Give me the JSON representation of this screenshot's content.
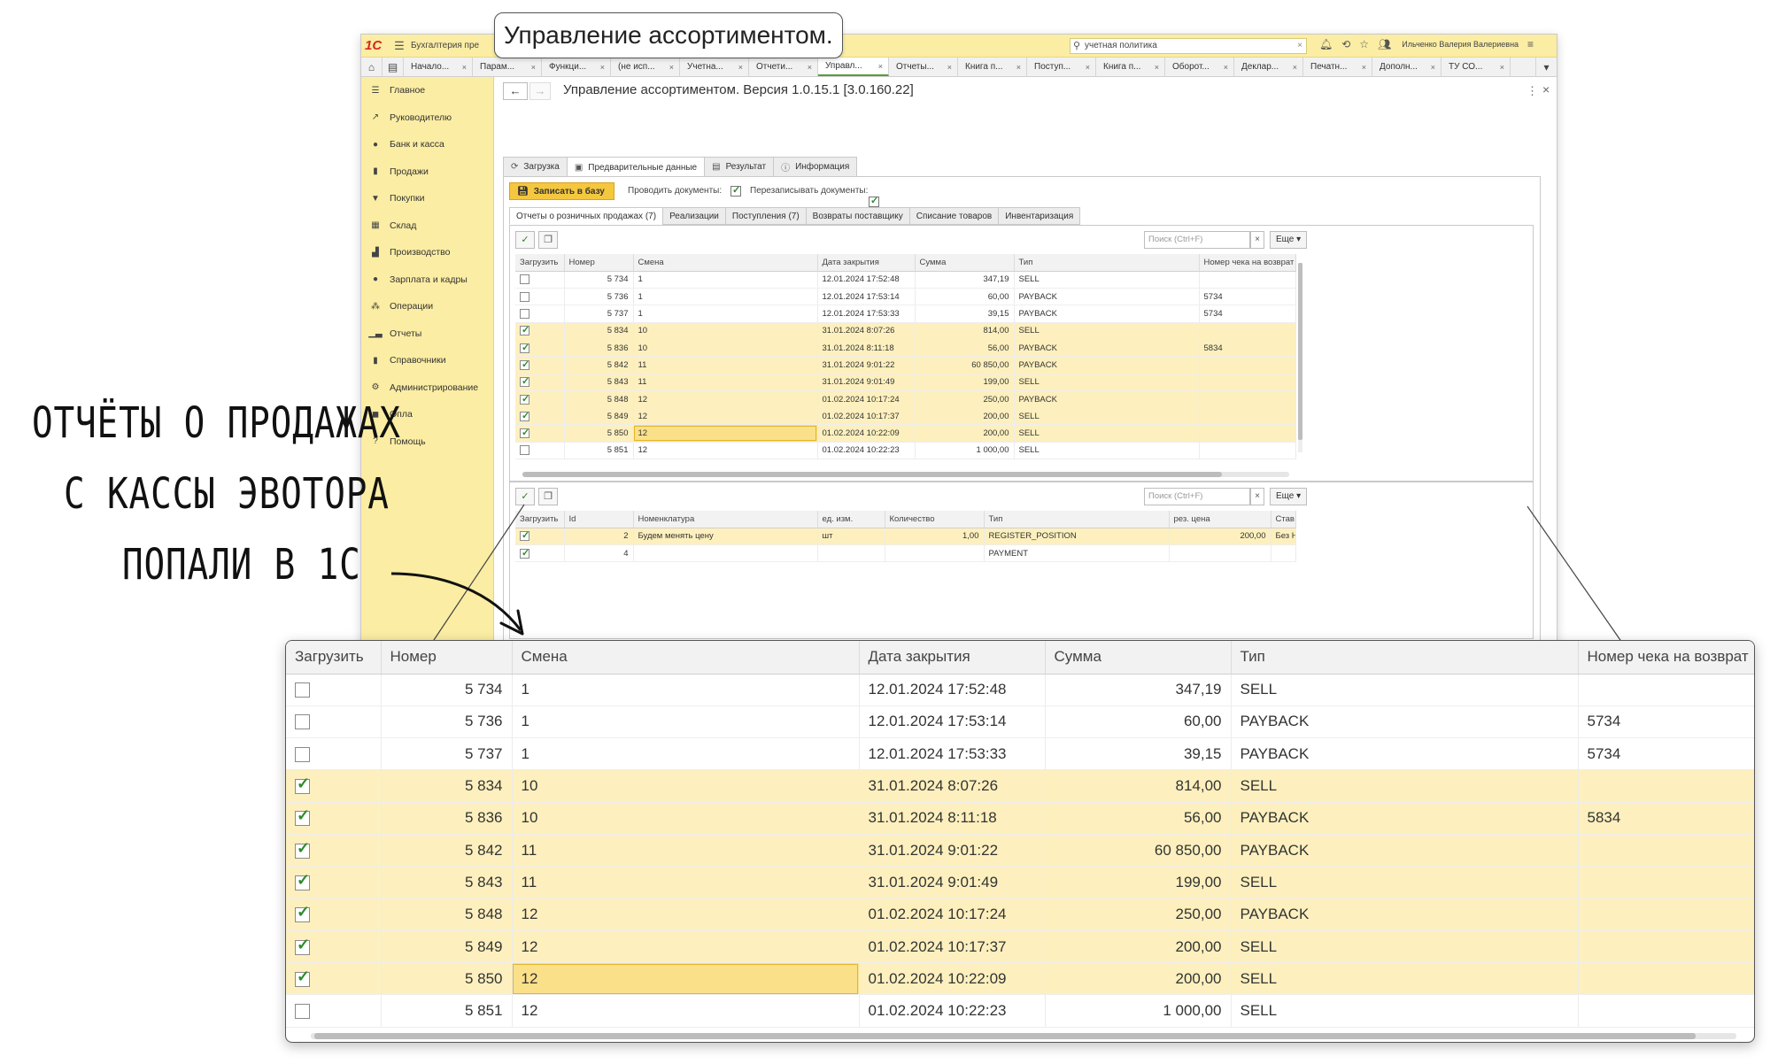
{
  "annotation": {
    "lines": [
      "ОТЧЁТЫ О ПРОДАЖАХ",
      "С КАССЫ ЭВОТОРА",
      "ПОПАЛИ В 1С"
    ]
  },
  "callout": {
    "text": "Управление ассортиментом."
  },
  "titlebar": {
    "logo": "1С",
    "app_name": "Бухгалтерия пре",
    "search_value": "учетная политика",
    "user": "Ильченко Валерия Валериевна"
  },
  "tabs": [
    {
      "label": "Начало..."
    },
    {
      "label": "Парам..."
    },
    {
      "label": "Функци..."
    },
    {
      "label": "(не исп..."
    },
    {
      "label": "Учетна..."
    },
    {
      "label": "Отчети..."
    },
    {
      "label": "Управл..."
    },
    {
      "label": "Отчеты..."
    },
    {
      "label": "Книга п..."
    },
    {
      "label": "Поступ..."
    },
    {
      "label": "Книга п..."
    },
    {
      "label": "Оборот..."
    },
    {
      "label": "Деклар..."
    },
    {
      "label": "Печатн..."
    },
    {
      "label": "Дополн..."
    },
    {
      "label": "ТУ СО..."
    }
  ],
  "active_tab_index": 6,
  "sidebar": {
    "items": [
      {
        "label": "Главное",
        "icon": "menu-icon"
      },
      {
        "label": "Руководителю",
        "icon": "trend-icon"
      },
      {
        "label": "Банк и касса",
        "icon": "coin-icon"
      },
      {
        "label": "Продажи",
        "icon": "bag-icon"
      },
      {
        "label": "Покупки",
        "icon": "cart-icon"
      },
      {
        "label": "Склад",
        "icon": "warehouse-icon"
      },
      {
        "label": "Производство",
        "icon": "factory-icon"
      },
      {
        "label": "Зарплата и кадры",
        "icon": "person-icon"
      },
      {
        "label": "Операции",
        "icon": "operations-icon"
      },
      {
        "label": "Отчеты",
        "icon": "bar-chart-icon"
      },
      {
        "label": "Справочники",
        "icon": "book-icon"
      },
      {
        "label": "Администрирование",
        "icon": "gear-icon"
      },
      {
        "label": "Опла",
        "icon": "payment-icon"
      },
      {
        "label": "Помощь",
        "icon": "help-icon"
      }
    ]
  },
  "form": {
    "title": "Управление ассортиментом. Версия 1.0.15.1 [3.0.160.22]",
    "tabs": [
      {
        "label": "Загрузка",
        "icon": "download-icon"
      },
      {
        "label": "Предварительные данные",
        "icon": "preview-icon"
      },
      {
        "label": "Результат",
        "icon": "result-icon"
      },
      {
        "label": "Информация",
        "icon": "info-icon"
      }
    ],
    "save_button": "Записать в базу",
    "post_docs_label": "Проводить документы:",
    "rewrite_docs_label": "Перезаписывать документы:",
    "subtabs": [
      {
        "label": "Отчеты о розничных продажах (7)"
      },
      {
        "label": "Реализации"
      },
      {
        "label": "Поступления (7)"
      },
      {
        "label": "Возвраты поставщику"
      },
      {
        "label": "Списание товаров"
      },
      {
        "label": "Инвентаризация"
      }
    ],
    "search_placeholder": "Поиск (Ctrl+F)",
    "more_label": "Еще",
    "more_label_arrow": "Еще ▾"
  },
  "main_table": {
    "columns": [
      "Загрузить",
      "Номер",
      "Смена",
      "Дата закрытия",
      "Сумма",
      "Тип",
      "Номер чека на возврат"
    ],
    "rows": [
      {
        "checked": false,
        "num": "5 734",
        "shift": "1",
        "date": "12.01.2024 17:52:48",
        "sum": "347,19",
        "type": "SELL",
        "ret": ""
      },
      {
        "checked": false,
        "num": "5 736",
        "shift": "1",
        "date": "12.01.2024 17:53:14",
        "sum": "60,00",
        "type": "PAYBACK",
        "ret": "5734"
      },
      {
        "checked": false,
        "num": "5 737",
        "shift": "1",
        "date": "12.01.2024 17:53:33",
        "sum": "39,15",
        "type": "PAYBACK",
        "ret": "5734"
      },
      {
        "checked": true,
        "num": "5 834",
        "shift": "10",
        "date": "31.01.2024 8:07:26",
        "sum": "814,00",
        "type": "SELL",
        "ret": ""
      },
      {
        "checked": true,
        "num": "5 836",
        "shift": "10",
        "date": "31.01.2024 8:11:18",
        "sum": "56,00",
        "type": "PAYBACK",
        "ret": "5834"
      },
      {
        "checked": true,
        "num": "5 842",
        "shift": "11",
        "date": "31.01.2024 9:01:22",
        "sum": "60 850,00",
        "type": "PAYBACK",
        "ret": ""
      },
      {
        "checked": true,
        "num": "5 843",
        "shift": "11",
        "date": "31.01.2024 9:01:49",
        "sum": "199,00",
        "type": "SELL",
        "ret": ""
      },
      {
        "checked": true,
        "num": "5 848",
        "shift": "12",
        "date": "01.02.2024 10:17:24",
        "sum": "250,00",
        "type": "PAYBACK",
        "ret": ""
      },
      {
        "checked": true,
        "num": "5 849",
        "shift": "12",
        "date": "01.02.2024 10:17:37",
        "sum": "200,00",
        "type": "SELL",
        "ret": ""
      },
      {
        "checked": true,
        "num": "5 850",
        "shift": "12",
        "date": "01.02.2024 10:22:09",
        "sum": "200,00",
        "type": "SELL",
        "ret": "",
        "current": true
      },
      {
        "checked": false,
        "num": "5 851",
        "shift": "12",
        "date": "01.02.2024 10:22:23",
        "sum": "1 000,00",
        "type": "SELL",
        "ret": ""
      }
    ]
  },
  "detail_table": {
    "columns": [
      "Загрузить",
      "Id",
      "Номенклатура",
      "ед. изм.",
      "Количество",
      "Тип",
      "рез. цена",
      "Став"
    ],
    "rows": [
      {
        "checked": true,
        "id": "2",
        "name": "Будем менять цену",
        "unit": "шт",
        "qty": "1,00",
        "type": "REGISTER_POSITION",
        "price": "200,00",
        "rate": "Без Н"
      },
      {
        "checked": true,
        "id": "4",
        "name": "",
        "unit": "",
        "qty": "",
        "type": "PAYMENT",
        "price": "",
        "rate": ""
      }
    ]
  },
  "colors": {
    "accent_yellow": "#fbeda3",
    "selected_row": "#fdf0be",
    "save_button": "#f5c73e",
    "check_green": "#2e8b2e"
  }
}
